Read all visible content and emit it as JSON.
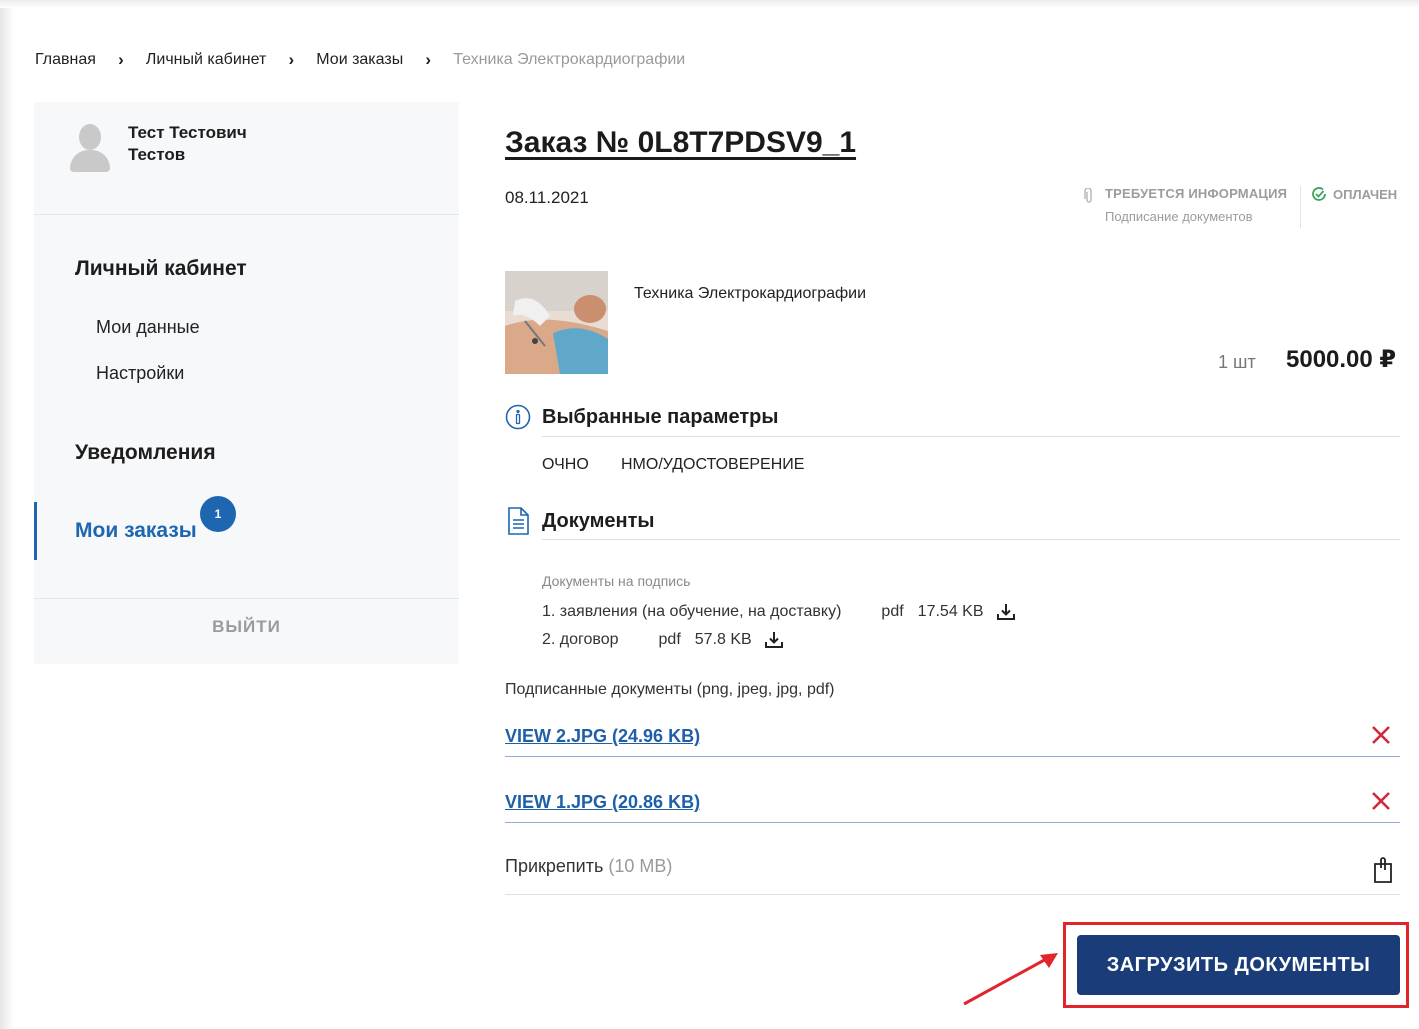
{
  "breadcrumb": {
    "home": "Главная",
    "cabinet": "Личный кабинет",
    "orders": "Мои заказы",
    "current": "Техника Электрокардиографии"
  },
  "sidebar": {
    "user_name": "Тест Тестович\nТестов",
    "section_cabinet": "Личный кабинет",
    "item_my_data": "Мои данные",
    "item_settings": "Настройки",
    "section_notifications": "Уведомления",
    "item_orders": "Мои заказы",
    "orders_badge": "1",
    "logout": "ВЫЙТИ"
  },
  "order": {
    "title": "Заказ № 0L8T7PDSV9_1",
    "date": "08.11.2021",
    "status_info_label": "ТРЕБУЕТСЯ ИНФОРМАЦИЯ",
    "status_info_sub": "Подписание документов",
    "status_paid_label": "ОПЛАЧЕН",
    "product_name": "Техника Электрокардиографии",
    "quantity": "1 шт",
    "price": "5000.00 ₽"
  },
  "params": {
    "title": "Выбранные параметры",
    "values": [
      "ОЧНО",
      "НМО/УДОСТОВЕРЕНИЕ"
    ]
  },
  "documents": {
    "title": "Документы",
    "caption": "Документы на подпись",
    "items": [
      {
        "name": "1. заявления (на обучение, на доставку)",
        "format": "pdf",
        "size": "17.54 KB"
      },
      {
        "name": "2. договор",
        "format": "pdf",
        "size": "57.8 KB"
      }
    ],
    "signed_caption": "Подписанные документы (png, jpeg, jpg, pdf)",
    "signed_files": [
      "VIEW 2.JPG (24.96 KB)",
      "VIEW 1.JPG (20.86 KB)"
    ],
    "attach_label": "Прикрепить",
    "attach_limit": "(10 MB)",
    "upload_button": "ЗАГРУЗИТЬ ДОКУМЕНТЫ"
  },
  "colors": {
    "accent": "#1e66b0",
    "button": "#1a3d7a",
    "remove": "#d3283a",
    "highlight": "#e2242b"
  },
  "icons": [
    "avatar-icon",
    "chevron-right-icon",
    "paperclip-icon",
    "check-circle-icon",
    "info-icon",
    "document-icon",
    "download-icon",
    "close-icon",
    "attach-file-icon",
    "annotation-arrow"
  ]
}
